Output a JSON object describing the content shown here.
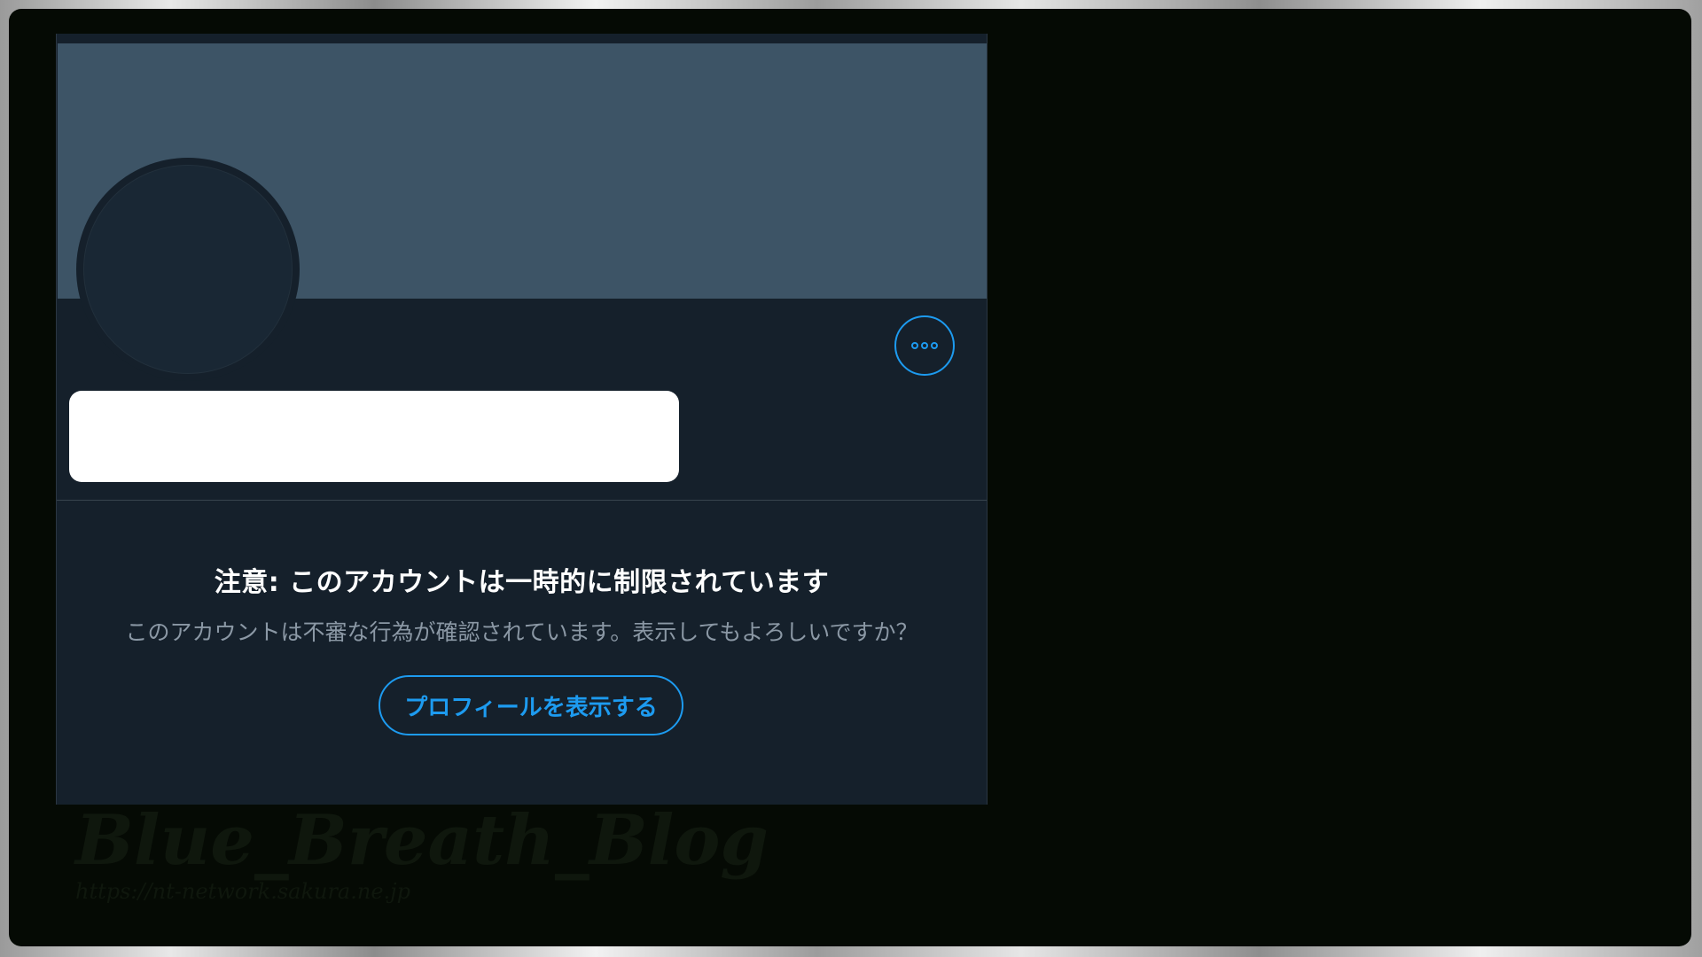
{
  "profile": {
    "more_icon": "more-horizontal-icon",
    "more_label": "•••"
  },
  "warning": {
    "title": "注意: このアカウントは一時的に制限されています",
    "description": "このアカウントは不審な行為が確認されています。表示してもよろしいですか？",
    "button_label": "プロフィールを表示する"
  },
  "watermark": {
    "title": "Blue_Breath_Blog",
    "url": "https://nt-network.sakura.ne.jp"
  },
  "colors": {
    "accent": "#1d9bf0",
    "card_background": "#15202b",
    "banner": "#3d5466"
  }
}
